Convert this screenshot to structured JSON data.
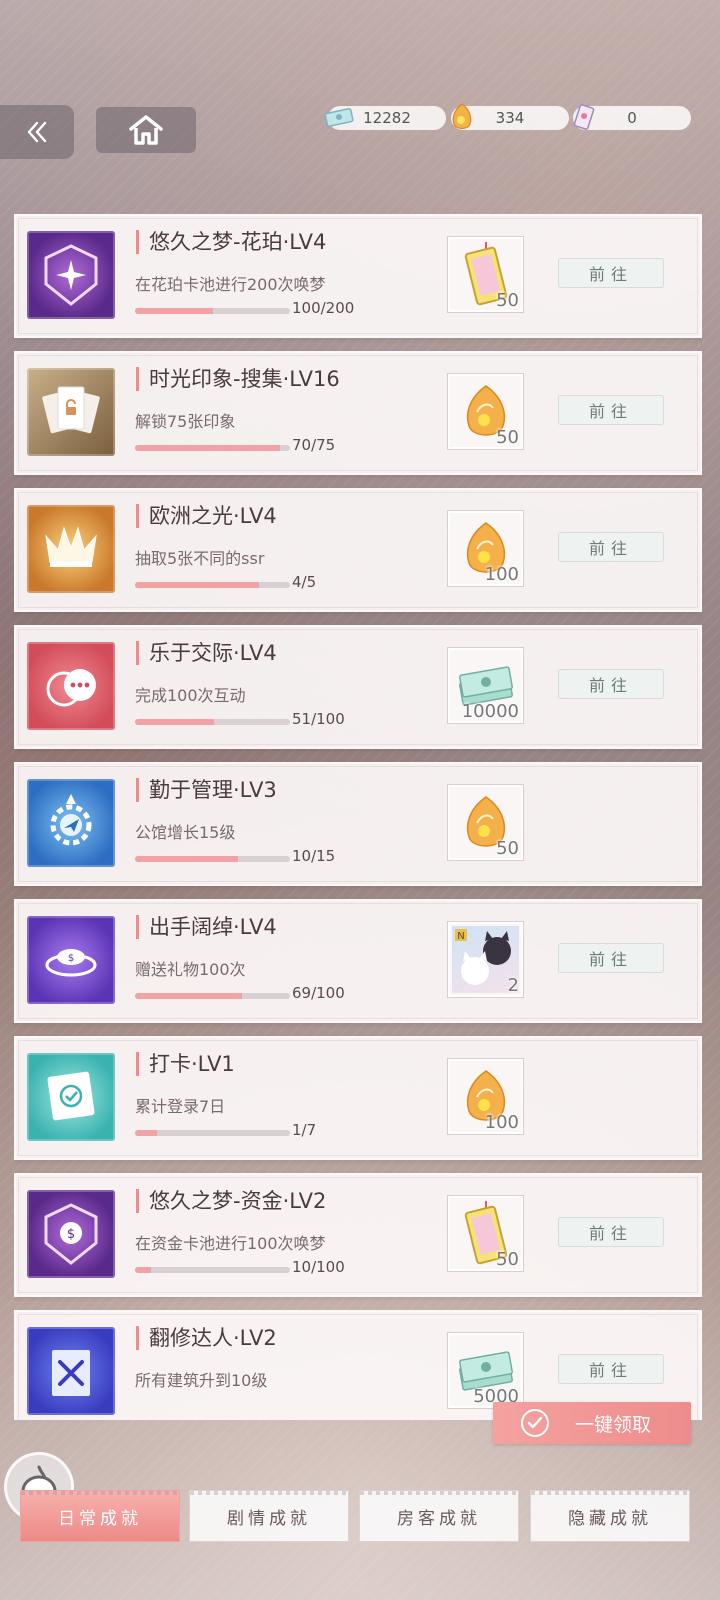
{
  "header": {
    "back_icon": "double-chevron-left-icon",
    "home_icon": "home-icon",
    "currencies": [
      {
        "icon": "cash-icon",
        "value": "12282"
      },
      {
        "icon": "amber-gem-icon",
        "value": "334"
      },
      {
        "icon": "ticket-icon",
        "value": "0"
      }
    ]
  },
  "colors": {
    "accent": "#f08a8e",
    "progress_fill": "#f0a2a4",
    "claim_button": "#ee8c8c"
  },
  "achievements": [
    {
      "title": "悠久之梦-花珀·LV4",
      "desc": "在花珀卡池进行200次唤梦",
      "progress_text": "100/200",
      "progress": 0.5,
      "reward_icon": "dream-ticket-icon",
      "reward_qty": "50",
      "button": "前往",
      "badge_icon": "purple-shield-flower-icon"
    },
    {
      "title": "时光印象-搜集·LV16",
      "desc": "解锁75张印象",
      "progress_text": "70/75",
      "progress": 0.933,
      "reward_icon": "amber-gem-icon",
      "reward_qty": "50",
      "button": "前往",
      "badge_icon": "cards-unlock-icon"
    },
    {
      "title": "欧洲之光·LV4",
      "desc": "抽取5张不同的ssr",
      "progress_text": "4/5",
      "progress": 0.8,
      "reward_icon": "amber-gem-icon",
      "reward_qty": "100",
      "button": "前往",
      "badge_icon": "golden-crown-icon"
    },
    {
      "title": "乐于交际·LV4",
      "desc": "完成100次互动",
      "progress_text": "51/100",
      "progress": 0.51,
      "reward_icon": "cash-stack-icon",
      "reward_qty": "10000",
      "button": "前往",
      "badge_icon": "chat-bubbles-icon"
    },
    {
      "title": "勤于管理·LV3",
      "desc": "公馆增长15级",
      "progress_text": "10/15",
      "progress": 0.667,
      "reward_icon": "amber-gem-icon",
      "reward_qty": "50",
      "button": "",
      "badge_icon": "gear-plane-icon"
    },
    {
      "title": "出手阔绰·LV4",
      "desc": "赠送礼物100次",
      "progress_text": "69/100",
      "progress": 0.69,
      "reward_icon": "cat-card-icon",
      "reward_qty": "2",
      "button": "前往",
      "badge_icon": "coin-ring-icon"
    },
    {
      "title": "打卡·LV1",
      "desc": "累计登录7日",
      "progress_text": "1/7",
      "progress": 0.143,
      "reward_icon": "amber-gem-icon",
      "reward_qty": "100",
      "button": "",
      "badge_icon": "checkmark-calendar-icon"
    },
    {
      "title": "悠久之梦-资金·LV2",
      "desc": "在资金卡池进行100次唤梦",
      "progress_text": "10/100",
      "progress": 0.1,
      "reward_icon": "dream-ticket-icon",
      "reward_qty": "50",
      "button": "前往",
      "badge_icon": "purple-shield-coin-icon"
    },
    {
      "title": "翻修达人·LV2",
      "desc": "所有建筑升到10级",
      "progress_text": "",
      "progress": 0,
      "reward_icon": "cash-stack-icon",
      "reward_qty": "5000",
      "button": "前往",
      "badge_icon": "tools-icon"
    }
  ],
  "claim_all": {
    "label": "一键领取",
    "icon": "check-circle-icon"
  },
  "mascot_icon": "mascot-icon",
  "tabs": [
    {
      "label": "日常成就",
      "active": true
    },
    {
      "label": "剧情成就",
      "active": false
    },
    {
      "label": "房客成就",
      "active": false
    },
    {
      "label": "隐藏成就",
      "active": false
    }
  ]
}
